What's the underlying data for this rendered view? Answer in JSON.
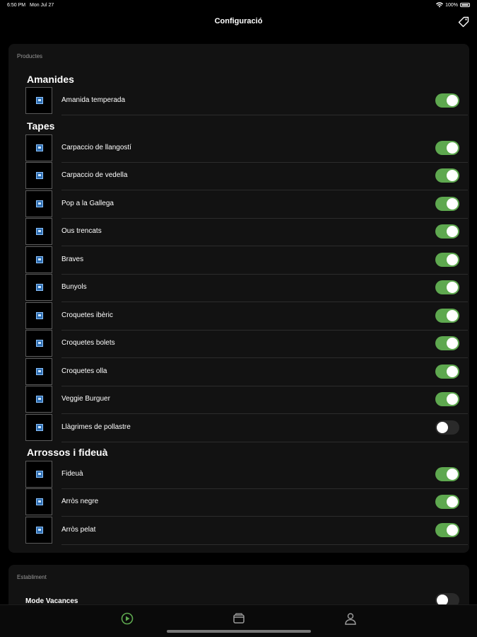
{
  "status": {
    "time": "6:50 PM",
    "date": "Mon Jul 27",
    "battery": "100%"
  },
  "nav": {
    "title": "Configuració",
    "action_icon": "tag-icon"
  },
  "products": {
    "header": "Productes",
    "categories": [
      {
        "name": "Amanides",
        "items": [
          {
            "name": "Amanida temperada",
            "enabled": true
          }
        ]
      },
      {
        "name": "Tapes",
        "items": [
          {
            "name": "Carpaccio de llangostí",
            "enabled": true
          },
          {
            "name": "Carpaccio de vedella",
            "enabled": true
          },
          {
            "name": "Pop a la Gallega",
            "enabled": true
          },
          {
            "name": "Ous trencats",
            "enabled": true
          },
          {
            "name": "Braves",
            "enabled": true
          },
          {
            "name": "Bunyols",
            "enabled": true
          },
          {
            "name": "Croquetes ibèric",
            "enabled": true
          },
          {
            "name": "Croquetes bolets",
            "enabled": true
          },
          {
            "name": "Croquetes olla",
            "enabled": true
          },
          {
            "name": "Veggie Burguer",
            "enabled": true
          },
          {
            "name": "Llàgrimes de pollastre",
            "enabled": false
          }
        ]
      },
      {
        "name": "Arrossos i fideuà",
        "items": [
          {
            "name": "Fideuà",
            "enabled": true
          },
          {
            "name": "Arròs negre",
            "enabled": true
          },
          {
            "name": "Arròs pelat",
            "enabled": true
          }
        ]
      }
    ]
  },
  "establishment": {
    "header": "Establiment",
    "vacation_mode": {
      "label": "Mode Vacances",
      "enabled": false
    }
  },
  "tabs": [
    {
      "icon": "play-circle-icon",
      "active": true
    },
    {
      "icon": "wallet-icon",
      "active": false
    },
    {
      "icon": "person-icon",
      "active": false
    }
  ],
  "colors": {
    "accent": "#5ea84f",
    "background": "#000000",
    "card": "#121212"
  }
}
